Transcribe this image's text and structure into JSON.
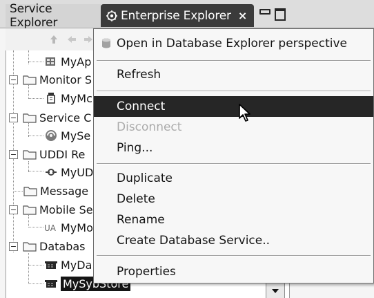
{
  "tabs": {
    "inactive_label": "Service Explorer",
    "active_label": "Enterprise Explorer",
    "close_glyph": "×"
  },
  "tree": {
    "items": [
      {
        "label": "MyAp",
        "level": 2,
        "icon": "app-icon"
      },
      {
        "label": "Monitor S",
        "level": 1,
        "icon": "folder-icon",
        "expander": "−"
      },
      {
        "label": "MyMc",
        "level": 2,
        "icon": "monitor-icon"
      },
      {
        "label": "Service C",
        "level": 1,
        "icon": "folder-icon",
        "expander": "−"
      },
      {
        "label": "MySe",
        "level": 2,
        "icon": "service-icon"
      },
      {
        "label": "UDDI Re",
        "level": 1,
        "icon": "folder-icon",
        "expander": "−"
      },
      {
        "label": "MyUD",
        "level": 2,
        "icon": "uddi-icon"
      },
      {
        "label": "Message",
        "level": 1,
        "icon": "folder-icon"
      },
      {
        "label": "Mobile Se",
        "level": 1,
        "icon": "folder-icon",
        "expander": "−"
      },
      {
        "label": "MyMo",
        "level": 2,
        "icon": "mobile-icon"
      },
      {
        "label": "Databas",
        "level": 1,
        "icon": "folder-icon",
        "expander": "−"
      },
      {
        "label": "MyDa",
        "level": 2,
        "icon": "database-icon"
      },
      {
        "label": "MySybStore",
        "level": 2,
        "icon": "database-icon",
        "selected": true
      }
    ]
  },
  "menu": {
    "items": [
      {
        "label": "Open in Database Explorer perspective",
        "icon": "database-explorer-icon"
      },
      {
        "label": "Refresh"
      },
      {
        "label": "Connect",
        "highlighted": true
      },
      {
        "label": "Disconnect",
        "disabled": true
      },
      {
        "label": "Ping..."
      },
      {
        "label": "Duplicate"
      },
      {
        "label": "Delete"
      },
      {
        "label": "Rename"
      },
      {
        "label": "Create Database Service.."
      },
      {
        "label": "Properties"
      }
    ]
  },
  "colors": {
    "highlight": "#2a2a2a",
    "active_tab": "#3e3e3e",
    "disabled_text": "#a9a9a9"
  }
}
